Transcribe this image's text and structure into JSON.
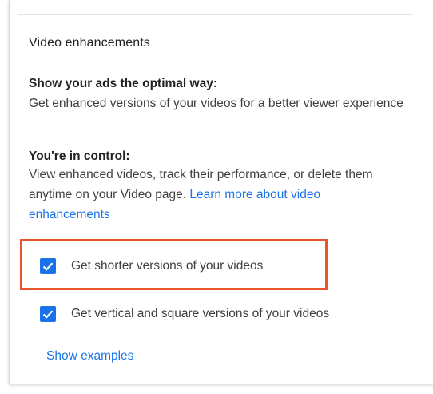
{
  "section": {
    "title": "Video enhancements"
  },
  "optimal": {
    "heading": "Show your ads the optimal way:",
    "text": "Get enhanced versions of your videos for a better viewer experience"
  },
  "control": {
    "heading": "You're in control:",
    "text": "View enhanced videos, track their performance, or delete them anytime on your Video page. ",
    "link": "Learn more about video enhancements"
  },
  "options": [
    {
      "label": "Get shorter versions of your videos",
      "checked": true
    },
    {
      "label": "Get vertical and square versions of your videos",
      "checked": true
    }
  ],
  "show_examples": "Show examples",
  "colors": {
    "accent": "#1a73e8",
    "highlight_border": "#e8552f"
  },
  "icons": {
    "checkbox": "checkmark-icon"
  }
}
